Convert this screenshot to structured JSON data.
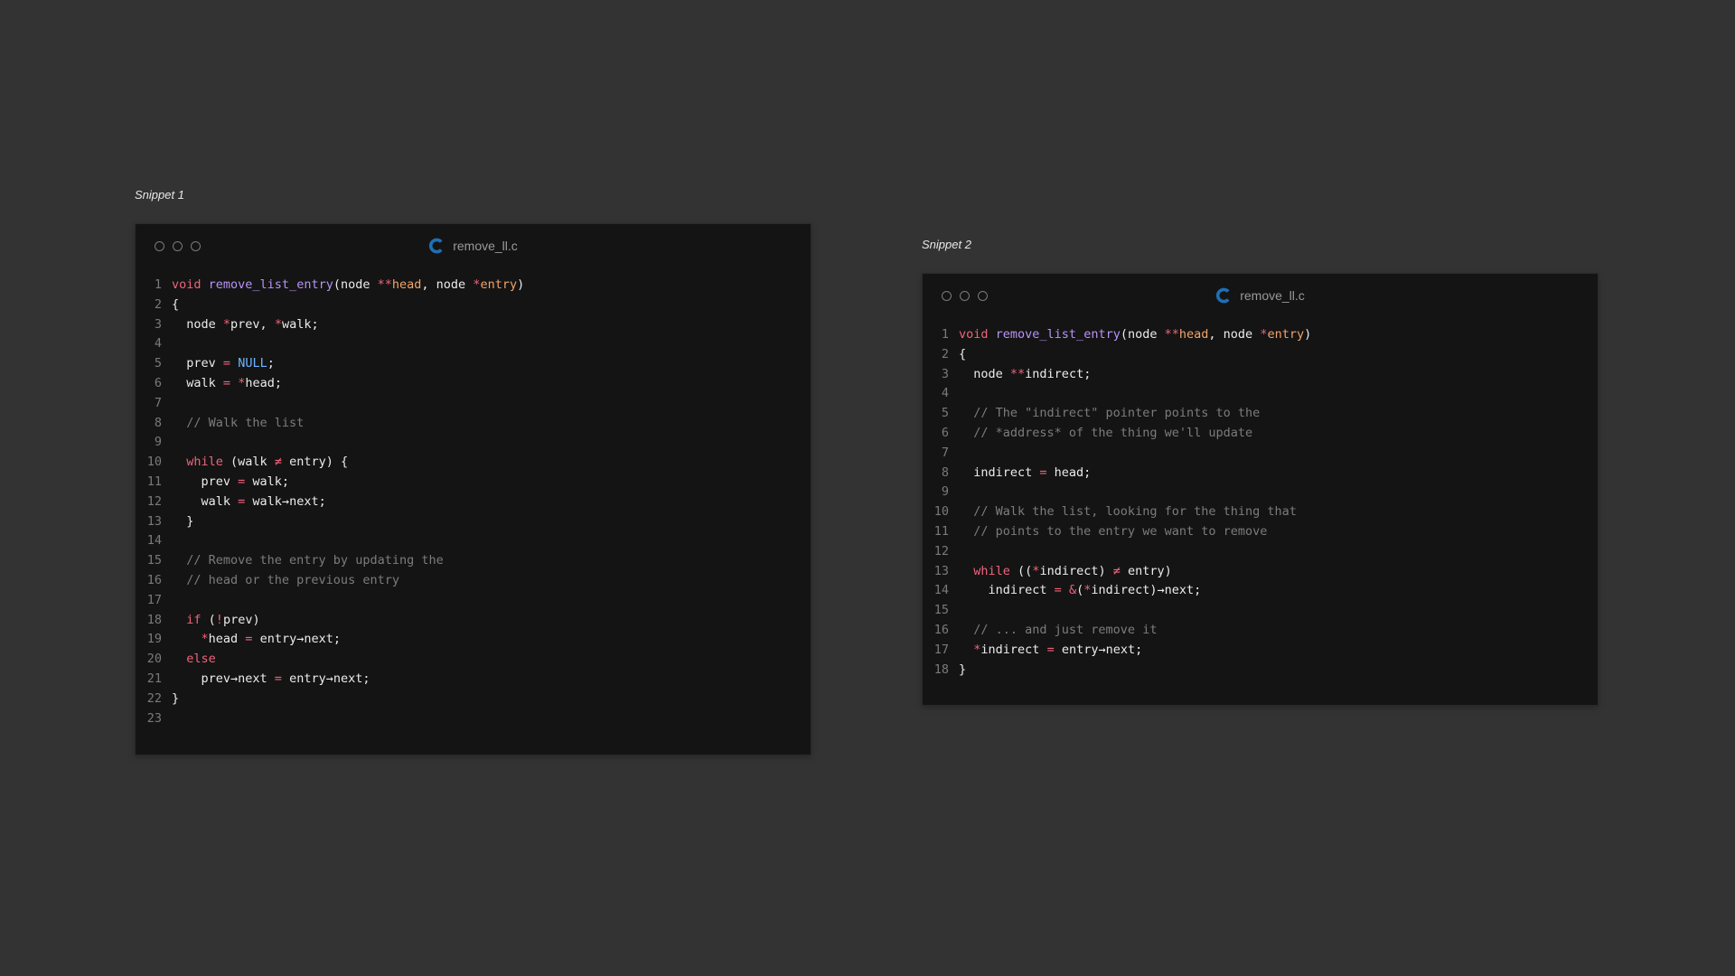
{
  "snippets": [
    {
      "label": "Snippet 1",
      "filename": "remove_ll.c",
      "language_icon": "c-language-icon",
      "lines": [
        [
          {
            "t": "kw",
            "v": "void"
          },
          {
            "t": "src",
            "v": " "
          },
          {
            "t": "fn",
            "v": "remove_list_entry"
          },
          {
            "t": "src",
            "v": "(node "
          },
          {
            "t": "op",
            "v": "**"
          },
          {
            "t": "param",
            "v": "head"
          },
          {
            "t": "src",
            "v": ", node "
          },
          {
            "t": "op",
            "v": "*"
          },
          {
            "t": "param",
            "v": "entry"
          },
          {
            "t": "src",
            "v": ")"
          }
        ],
        [
          {
            "t": "src",
            "v": "{"
          }
        ],
        [
          {
            "t": "src",
            "v": "  node "
          },
          {
            "t": "op",
            "v": "*"
          },
          {
            "t": "src",
            "v": "prev, "
          },
          {
            "t": "op",
            "v": "*"
          },
          {
            "t": "src",
            "v": "walk;"
          }
        ],
        [],
        [
          {
            "t": "src",
            "v": "  prev "
          },
          {
            "t": "op",
            "v": "="
          },
          {
            "t": "src",
            "v": " "
          },
          {
            "t": "const",
            "v": "NULL"
          },
          {
            "t": "src",
            "v": ";"
          }
        ],
        [
          {
            "t": "src",
            "v": "  walk "
          },
          {
            "t": "op",
            "v": "="
          },
          {
            "t": "src",
            "v": " "
          },
          {
            "t": "op",
            "v": "*"
          },
          {
            "t": "src",
            "v": "head;"
          }
        ],
        [],
        [
          {
            "t": "cm",
            "v": "  // Walk the list"
          }
        ],
        [],
        [
          {
            "t": "src",
            "v": "  "
          },
          {
            "t": "kw",
            "v": "while"
          },
          {
            "t": "src",
            "v": " (walk "
          },
          {
            "t": "op",
            "v": "≠"
          },
          {
            "t": "src",
            "v": " entry) {"
          }
        ],
        [
          {
            "t": "src",
            "v": "    prev "
          },
          {
            "t": "op",
            "v": "="
          },
          {
            "t": "src",
            "v": " walk;"
          }
        ],
        [
          {
            "t": "src",
            "v": "    walk "
          },
          {
            "t": "op",
            "v": "="
          },
          {
            "t": "src",
            "v": " walk→next;"
          }
        ],
        [
          {
            "t": "src",
            "v": "  }"
          }
        ],
        [],
        [
          {
            "t": "cm",
            "v": "  // Remove the entry by updating the"
          }
        ],
        [
          {
            "t": "cm",
            "v": "  // head or the previous entry"
          }
        ],
        [],
        [
          {
            "t": "src",
            "v": "  "
          },
          {
            "t": "kw",
            "v": "if"
          },
          {
            "t": "src",
            "v": " ("
          },
          {
            "t": "op",
            "v": "!"
          },
          {
            "t": "src",
            "v": "prev)"
          }
        ],
        [
          {
            "t": "src",
            "v": "    "
          },
          {
            "t": "op",
            "v": "*"
          },
          {
            "t": "src",
            "v": "head "
          },
          {
            "t": "op",
            "v": "="
          },
          {
            "t": "src",
            "v": " entry→next;"
          }
        ],
        [
          {
            "t": "src",
            "v": "  "
          },
          {
            "t": "kw",
            "v": "else"
          }
        ],
        [
          {
            "t": "src",
            "v": "    prev→next "
          },
          {
            "t": "op",
            "v": "="
          },
          {
            "t": "src",
            "v": " entry→next;"
          }
        ],
        [
          {
            "t": "src",
            "v": "}"
          }
        ],
        []
      ]
    },
    {
      "label": "Snippet 2",
      "filename": "remove_ll.c",
      "language_icon": "c-language-icon",
      "lines": [
        [
          {
            "t": "kw",
            "v": "void"
          },
          {
            "t": "src",
            "v": " "
          },
          {
            "t": "fn",
            "v": "remove_list_entry"
          },
          {
            "t": "src",
            "v": "(node "
          },
          {
            "t": "op",
            "v": "**"
          },
          {
            "t": "param",
            "v": "head"
          },
          {
            "t": "src",
            "v": ", node "
          },
          {
            "t": "op",
            "v": "*"
          },
          {
            "t": "param",
            "v": "entry"
          },
          {
            "t": "src",
            "v": ")"
          }
        ],
        [
          {
            "t": "src",
            "v": "{"
          }
        ],
        [
          {
            "t": "src",
            "v": "  node "
          },
          {
            "t": "op",
            "v": "**"
          },
          {
            "t": "src",
            "v": "indirect;"
          }
        ],
        [],
        [
          {
            "t": "cm",
            "v": "  // The \"indirect\" pointer points to the"
          }
        ],
        [
          {
            "t": "cm",
            "v": "  // *address* of the thing we'll update"
          }
        ],
        [],
        [
          {
            "t": "src",
            "v": "  indirect "
          },
          {
            "t": "op",
            "v": "="
          },
          {
            "t": "src",
            "v": " head;"
          }
        ],
        [],
        [
          {
            "t": "cm",
            "v": "  // Walk the list, looking for the thing that"
          }
        ],
        [
          {
            "t": "cm",
            "v": "  // points to the entry we want to remove"
          }
        ],
        [],
        [
          {
            "t": "src",
            "v": "  "
          },
          {
            "t": "kw",
            "v": "while"
          },
          {
            "t": "src",
            "v": " (("
          },
          {
            "t": "op",
            "v": "*"
          },
          {
            "t": "src",
            "v": "indirect) "
          },
          {
            "t": "op",
            "v": "≠"
          },
          {
            "t": "src",
            "v": " entry)"
          }
        ],
        [
          {
            "t": "src",
            "v": "    indirect "
          },
          {
            "t": "op",
            "v": "="
          },
          {
            "t": "src",
            "v": " "
          },
          {
            "t": "op",
            "v": "&"
          },
          {
            "t": "src",
            "v": "("
          },
          {
            "t": "op",
            "v": "*"
          },
          {
            "t": "src",
            "v": "indirect)→next;"
          }
        ],
        [],
        [
          {
            "t": "cm",
            "v": "  // ... and just remove it"
          }
        ],
        [
          {
            "t": "src",
            "v": "  "
          },
          {
            "t": "op",
            "v": "*"
          },
          {
            "t": "src",
            "v": "indirect "
          },
          {
            "t": "op",
            "v": "="
          },
          {
            "t": "src",
            "v": " entry→next;"
          }
        ],
        [
          {
            "t": "src",
            "v": "}"
          }
        ]
      ]
    }
  ],
  "colors": {
    "background": "#333333",
    "window": "#141414",
    "keyword": "#f0637b",
    "function": "#b794f6",
    "parameter": "#f2a46b",
    "constant": "#6fb3ff",
    "comment": "#7c7c7c",
    "c_icon": "#1f6fb5"
  }
}
